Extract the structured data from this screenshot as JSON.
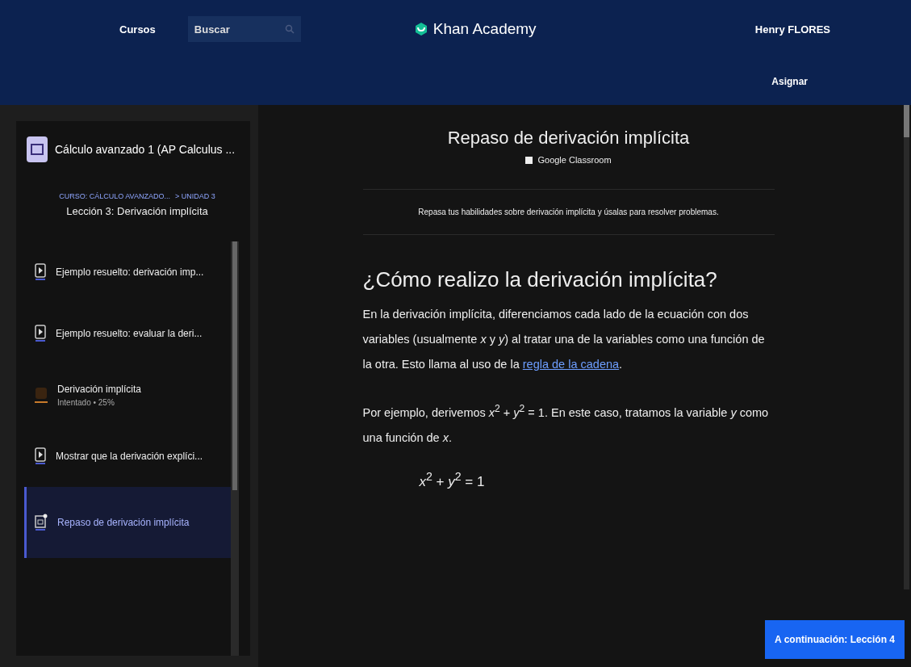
{
  "header": {
    "nav_link": "Cursos",
    "search": {
      "placeholder": "Buscar"
    },
    "logo": "Khan Academy",
    "user": "Henry FLORES",
    "assign": "Asignar"
  },
  "sidebar": {
    "course_title": "Cálculo avanzado 1 (AP Calculus ...",
    "breadcrumb": [
      "CURSO: CÁLCULO AVANZADO...",
      "> UNIDAD 3"
    ],
    "lesson": "Lección 3: Derivación implícita",
    "items": [
      {
        "kind": "video",
        "title": "Ejemplo resuelto: derivación imp...",
        "selected": false
      },
      {
        "kind": "video",
        "title": "Ejemplo resuelto: evaluar la deri...",
        "selected": false
      },
      {
        "kind": "exercise",
        "title": "Derivación implícita",
        "subtitle": "Intentado • 25%",
        "selected": false
      },
      {
        "kind": "video",
        "title": "Mostrar que la derivación explíci...",
        "selected": false
      },
      {
        "kind": "article",
        "title": "Repaso de derivación implícita",
        "selected": true
      }
    ]
  },
  "article": {
    "title": "Repaso de derivación implícita",
    "classroom": "Google Classroom",
    "summary": "Repasa tus habilidades sobre derivación implícita y úsalas para resolver problemas.",
    "heading": "¿Cómo realizo la derivación implícita?",
    "paragraph_1": "En la derivación implícita, diferenciamos cada lado de la ecuación con dos variables (usualmente *x* y *y*) al tratar una de la variables como una función de la otra. Esto llama al uso de la",
    "link": "regla de la cadena",
    "paragraph_1_end": ".",
    "paragraph_2": "Por ejemplo, derivemos *x*$^{2}$ + *y*$^{2}$ = 1. En este caso, tratamos la variable *y* como una función de *x*.",
    "equation": "*x*$^{2}$ + *y*$^{2}$ = 1"
  },
  "next_button": "A continuación: Lección 4"
}
